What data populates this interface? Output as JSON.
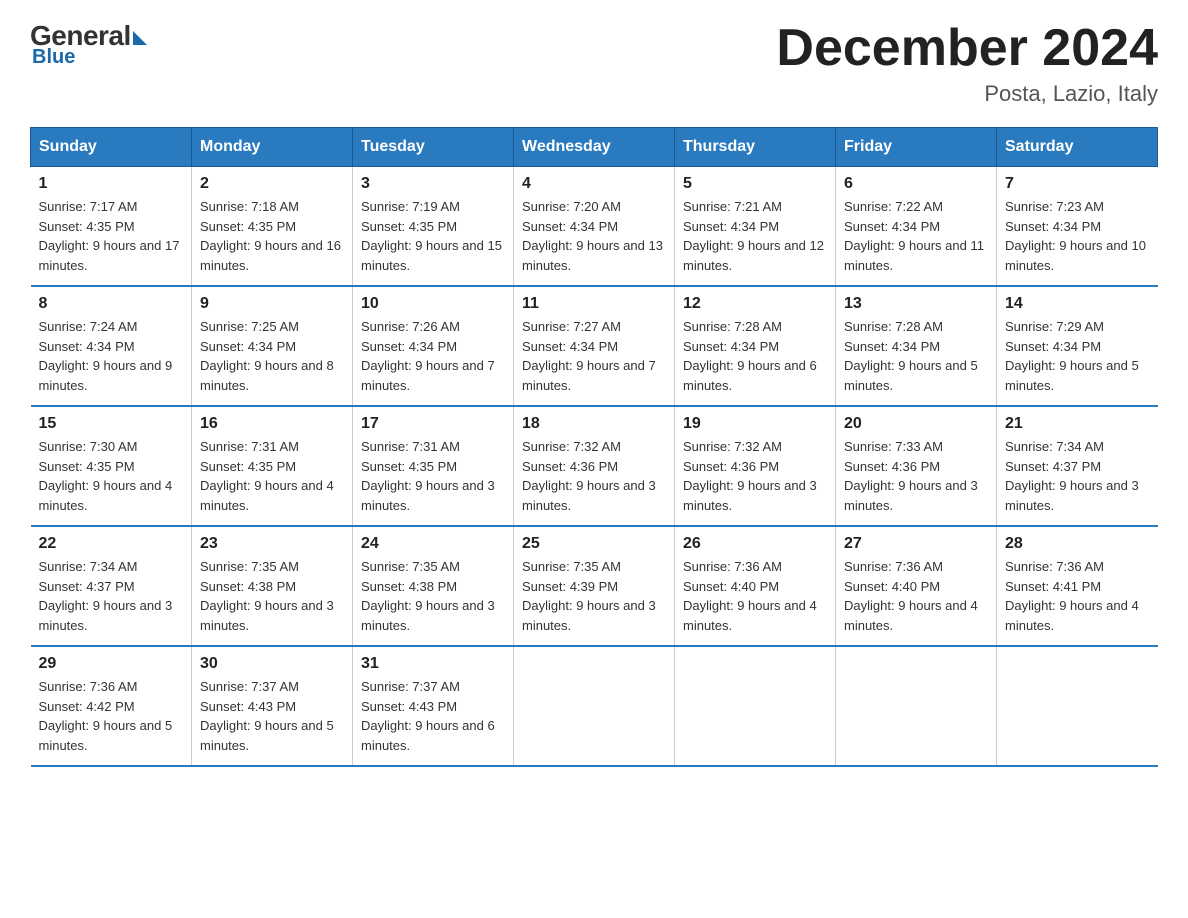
{
  "header": {
    "logo_general": "General",
    "logo_blue": "Blue",
    "month_title": "December 2024",
    "location": "Posta, Lazio, Italy"
  },
  "days_of_week": [
    "Sunday",
    "Monday",
    "Tuesday",
    "Wednesday",
    "Thursday",
    "Friday",
    "Saturday"
  ],
  "weeks": [
    [
      {
        "day": "1",
        "sunrise": "7:17 AM",
        "sunset": "4:35 PM",
        "daylight": "9 hours and 17 minutes."
      },
      {
        "day": "2",
        "sunrise": "7:18 AM",
        "sunset": "4:35 PM",
        "daylight": "9 hours and 16 minutes."
      },
      {
        "day": "3",
        "sunrise": "7:19 AM",
        "sunset": "4:35 PM",
        "daylight": "9 hours and 15 minutes."
      },
      {
        "day": "4",
        "sunrise": "7:20 AM",
        "sunset": "4:34 PM",
        "daylight": "9 hours and 13 minutes."
      },
      {
        "day": "5",
        "sunrise": "7:21 AM",
        "sunset": "4:34 PM",
        "daylight": "9 hours and 12 minutes."
      },
      {
        "day": "6",
        "sunrise": "7:22 AM",
        "sunset": "4:34 PM",
        "daylight": "9 hours and 11 minutes."
      },
      {
        "day": "7",
        "sunrise": "7:23 AM",
        "sunset": "4:34 PM",
        "daylight": "9 hours and 10 minutes."
      }
    ],
    [
      {
        "day": "8",
        "sunrise": "7:24 AM",
        "sunset": "4:34 PM",
        "daylight": "9 hours and 9 minutes."
      },
      {
        "day": "9",
        "sunrise": "7:25 AM",
        "sunset": "4:34 PM",
        "daylight": "9 hours and 8 minutes."
      },
      {
        "day": "10",
        "sunrise": "7:26 AM",
        "sunset": "4:34 PM",
        "daylight": "9 hours and 7 minutes."
      },
      {
        "day": "11",
        "sunrise": "7:27 AM",
        "sunset": "4:34 PM",
        "daylight": "9 hours and 7 minutes."
      },
      {
        "day": "12",
        "sunrise": "7:28 AM",
        "sunset": "4:34 PM",
        "daylight": "9 hours and 6 minutes."
      },
      {
        "day": "13",
        "sunrise": "7:28 AM",
        "sunset": "4:34 PM",
        "daylight": "9 hours and 5 minutes."
      },
      {
        "day": "14",
        "sunrise": "7:29 AM",
        "sunset": "4:34 PM",
        "daylight": "9 hours and 5 minutes."
      }
    ],
    [
      {
        "day": "15",
        "sunrise": "7:30 AM",
        "sunset": "4:35 PM",
        "daylight": "9 hours and 4 minutes."
      },
      {
        "day": "16",
        "sunrise": "7:31 AM",
        "sunset": "4:35 PM",
        "daylight": "9 hours and 4 minutes."
      },
      {
        "day": "17",
        "sunrise": "7:31 AM",
        "sunset": "4:35 PM",
        "daylight": "9 hours and 3 minutes."
      },
      {
        "day": "18",
        "sunrise": "7:32 AM",
        "sunset": "4:36 PM",
        "daylight": "9 hours and 3 minutes."
      },
      {
        "day": "19",
        "sunrise": "7:32 AM",
        "sunset": "4:36 PM",
        "daylight": "9 hours and 3 minutes."
      },
      {
        "day": "20",
        "sunrise": "7:33 AM",
        "sunset": "4:36 PM",
        "daylight": "9 hours and 3 minutes."
      },
      {
        "day": "21",
        "sunrise": "7:34 AM",
        "sunset": "4:37 PM",
        "daylight": "9 hours and 3 minutes."
      }
    ],
    [
      {
        "day": "22",
        "sunrise": "7:34 AM",
        "sunset": "4:37 PM",
        "daylight": "9 hours and 3 minutes."
      },
      {
        "day": "23",
        "sunrise": "7:35 AM",
        "sunset": "4:38 PM",
        "daylight": "9 hours and 3 minutes."
      },
      {
        "day": "24",
        "sunrise": "7:35 AM",
        "sunset": "4:38 PM",
        "daylight": "9 hours and 3 minutes."
      },
      {
        "day": "25",
        "sunrise": "7:35 AM",
        "sunset": "4:39 PM",
        "daylight": "9 hours and 3 minutes."
      },
      {
        "day": "26",
        "sunrise": "7:36 AM",
        "sunset": "4:40 PM",
        "daylight": "9 hours and 4 minutes."
      },
      {
        "day": "27",
        "sunrise": "7:36 AM",
        "sunset": "4:40 PM",
        "daylight": "9 hours and 4 minutes."
      },
      {
        "day": "28",
        "sunrise": "7:36 AM",
        "sunset": "4:41 PM",
        "daylight": "9 hours and 4 minutes."
      }
    ],
    [
      {
        "day": "29",
        "sunrise": "7:36 AM",
        "sunset": "4:42 PM",
        "daylight": "9 hours and 5 minutes."
      },
      {
        "day": "30",
        "sunrise": "7:37 AM",
        "sunset": "4:43 PM",
        "daylight": "9 hours and 5 minutes."
      },
      {
        "day": "31",
        "sunrise": "7:37 AM",
        "sunset": "4:43 PM",
        "daylight": "9 hours and 6 minutes."
      },
      {
        "day": "",
        "sunrise": "",
        "sunset": "",
        "daylight": ""
      },
      {
        "day": "",
        "sunrise": "",
        "sunset": "",
        "daylight": ""
      },
      {
        "day": "",
        "sunrise": "",
        "sunset": "",
        "daylight": ""
      },
      {
        "day": "",
        "sunrise": "",
        "sunset": "",
        "daylight": ""
      }
    ]
  ],
  "labels": {
    "sunrise_prefix": "Sunrise: ",
    "sunset_prefix": "Sunset: ",
    "daylight_prefix": "Daylight: "
  }
}
